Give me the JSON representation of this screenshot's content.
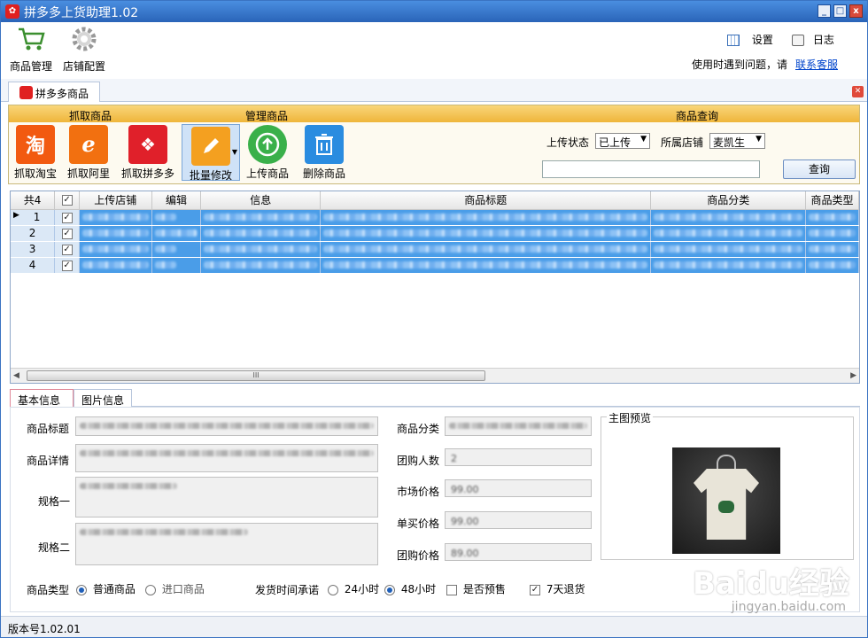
{
  "window": {
    "title": "拼多多上货助理1.02",
    "min": "_",
    "max": "□",
    "close": "x"
  },
  "toolbar": {
    "goods_mgmt": "商品管理",
    "store_config": "店铺配置",
    "settings": "设置",
    "log": "日志",
    "help_text": "使用时遇到问题，请",
    "help_link": "联系客服"
  },
  "doc_tab": {
    "label": "拼多多商品"
  },
  "ribbon": {
    "groups": {
      "fetch": "抓取商品",
      "manage": "管理商品",
      "query": "商品查询"
    },
    "buttons": {
      "taobao": "抓取淘宝",
      "taobao_glyph": "淘",
      "alibaba": "抓取阿里",
      "pdd": "抓取拼多多",
      "batch_edit": "批量修改",
      "upload": "上传商品",
      "delete": "删除商品"
    },
    "upload_status_label": "上传状态",
    "upload_status_value": "已上传",
    "store_label": "所属店铺",
    "store_value": "麦凯生",
    "query_button": "查询"
  },
  "grid": {
    "columns": [
      "共4",
      "",
      "上传店铺",
      "编辑",
      "信息",
      "商品标题",
      "商品分类",
      "商品类型"
    ],
    "rows": [
      {
        "index": "1",
        "checked": true,
        "current": true
      },
      {
        "index": "2",
        "checked": true,
        "current": false
      },
      {
        "index": "3",
        "checked": true,
        "current": false
      },
      {
        "index": "4",
        "checked": true,
        "current": false
      }
    ],
    "scroll_thumb": "III"
  },
  "detail_tabs": [
    "基本信息",
    "图片信息"
  ],
  "detail": {
    "title_label": "商品标题",
    "desc_label": "商品详情",
    "spec1_label": "规格一",
    "spec2_label": "规格二",
    "category_label": "商品分类",
    "group_count_label": "团购人数",
    "group_count_value": "2",
    "market_price_label": "市场价格",
    "market_price_value": "99.00",
    "single_price_label": "单买价格",
    "single_price_value": "99.00",
    "group_price_label": "团购价格",
    "group_price_value": "89.00",
    "preview_label": "主图预览",
    "goods_type_label": "商品类型",
    "goods_type_opt1": "普通商品",
    "goods_type_opt2": "进口商品",
    "ship_label": "发货时间承诺",
    "ship_opt1": "24小时",
    "ship_opt2": "48小时",
    "presale": "是否预售",
    "return7": "7天退货"
  },
  "status": {
    "version": "版本号1.02.01"
  },
  "watermark": {
    "logo": "Baidu经验",
    "url": "jingyan.baidu.com"
  }
}
